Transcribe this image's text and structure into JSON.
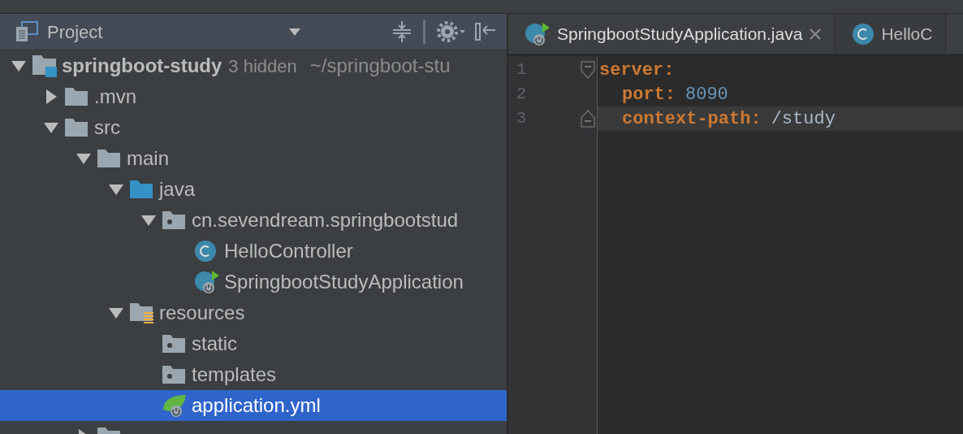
{
  "project_panel": {
    "title": "Project"
  },
  "tree": [
    {
      "kind": "module",
      "name": "springboot-study",
      "hint": "3 hidden",
      "path": "~/springboot-stu",
      "expanded": true,
      "selected": false,
      "children": [
        {
          "kind": "folder",
          "name": ".mvn",
          "expanded": false,
          "selected": false
        },
        {
          "kind": "folder",
          "name": "src",
          "expanded": true,
          "selected": false,
          "children": [
            {
              "kind": "folder",
              "name": "main",
              "expanded": true,
              "selected": false,
              "children": [
                {
                  "kind": "source-folder",
                  "name": "java",
                  "expanded": true,
                  "selected": false,
                  "children": [
                    {
                      "kind": "package",
                      "name": "cn.sevendream.springbootstud",
                      "expanded": true,
                      "selected": false,
                      "children": [
                        {
                          "kind": "class",
                          "name": "HelloController",
                          "selected": false
                        },
                        {
                          "kind": "spring-class",
                          "name": "SpringbootStudyApplication",
                          "selected": false
                        }
                      ]
                    }
                  ]
                },
                {
                  "kind": "resources-folder",
                  "name": "resources",
                  "expanded": true,
                  "selected": false,
                  "children": [
                    {
                      "kind": "package",
                      "name": "static",
                      "selected": false
                    },
                    {
                      "kind": "package",
                      "name": "templates",
                      "selected": false
                    },
                    {
                      "kind": "yml",
                      "name": "application.yml",
                      "selected": true
                    }
                  ]
                }
              ]
            },
            {
              "kind": "folder",
              "expanded": false,
              "selected": false
            }
          ]
        }
      ]
    }
  ],
  "editor_tabs": [
    {
      "kind": "spring-class",
      "label": "SpringbootStudyApplication.java",
      "selected": true,
      "closable": true
    },
    {
      "kind": "class",
      "label": "HelloC",
      "selected": false,
      "closable": false
    }
  ],
  "code_lines": [
    {
      "number": "1",
      "tokens": [
        {
          "kind": "key",
          "text": "server:"
        }
      ],
      "current": false,
      "children": [
        {
          "number": "2",
          "tokens": [
            {
              "kind": "key",
              "text": "port:"
            },
            {
              "kind": "number",
              "text": "8090"
            }
          ],
          "current": false
        },
        {
          "number": "3",
          "tokens": [
            {
              "kind": "key",
              "text": "context-path:"
            },
            {
              "kind": "string",
              "text": "/study"
            }
          ],
          "current": true
        }
      ]
    }
  ]
}
